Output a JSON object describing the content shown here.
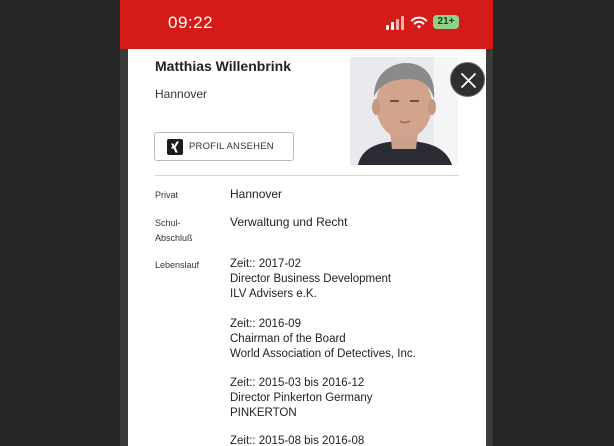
{
  "statusbar": {
    "time": "09:22",
    "battery": "21+",
    "icons": [
      "signal-icon",
      "wifi-icon",
      "battery-icon"
    ]
  },
  "profile": {
    "name": "Matthias Willenbrink",
    "city": "Hannover",
    "button_label": "PROFIL ANSEHEN",
    "button_icon": "xing-icon"
  },
  "details": {
    "privat_label": "Privat",
    "privat_value": "Hannover",
    "schul_label_line1": "Schul-",
    "schul_label_line2": "Abschluß",
    "schul_value": "Verwaltung und Recht",
    "lebenslauf_label": "Lebenslauf"
  },
  "career": [
    {
      "period": "Zeit:: 2017-02",
      "role": "Director Business Development",
      "company": "ILV Advisers e.K."
    },
    {
      "period": "Zeit:: 2016-09",
      "role": "Chairman of the Board",
      "company": "World Association of Detectives, Inc."
    },
    {
      "period": "Zeit:: 2015-03 bis 2016-12",
      "role": "Director Pinkerton Germany",
      "company": "PINKERTON"
    },
    {
      "period": "Zeit:: 2015-08 bis 2016-08",
      "role": "",
      "company": ""
    }
  ],
  "colors": {
    "statusbar": "#d41b17",
    "backdrop": "#262626",
    "card": "#ffffff",
    "battery": "#8fd18b"
  }
}
